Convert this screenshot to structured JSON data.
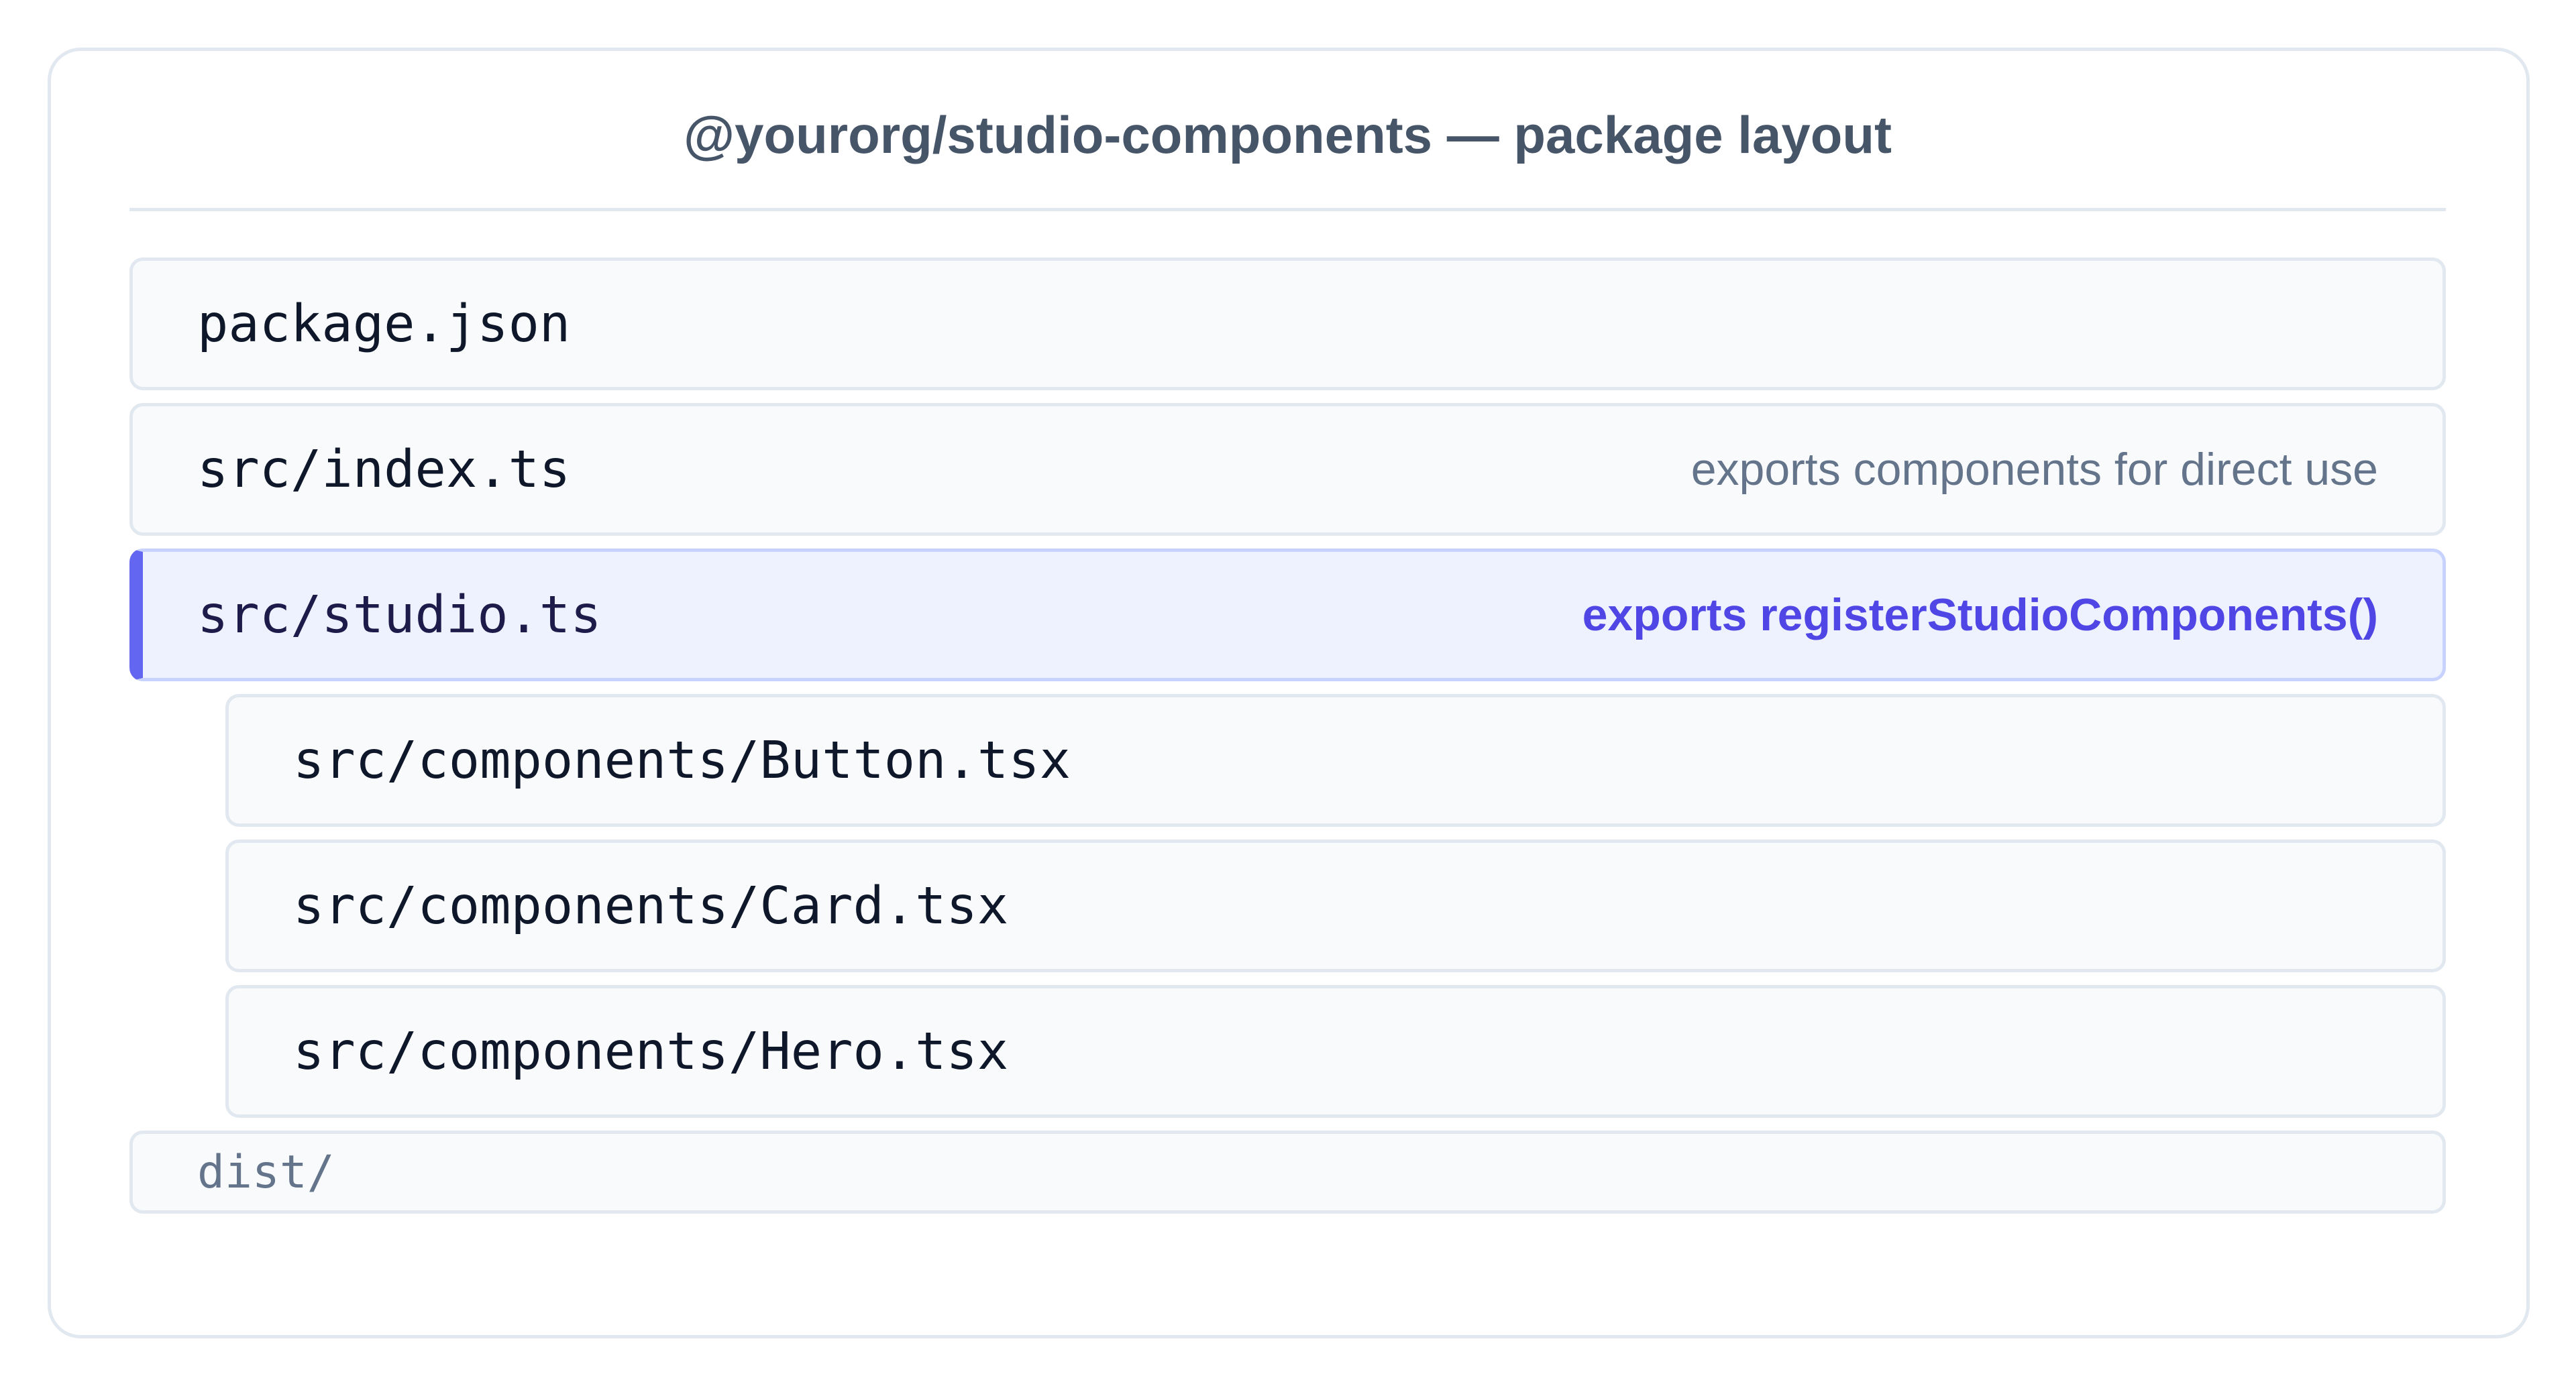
{
  "title": "@yourorg/studio-components — package layout",
  "rows": [
    {
      "path": "package.json",
      "note": ""
    },
    {
      "path": "src/index.ts",
      "note": "exports components for direct use"
    },
    {
      "path": "src/studio.ts",
      "note": "exports registerStudioComponents()"
    },
    {
      "path": "src/components/Button.tsx",
      "note": ""
    },
    {
      "path": "src/components/Card.tsx",
      "note": ""
    },
    {
      "path": "src/components/Hero.tsx",
      "note": ""
    },
    {
      "path": "dist/",
      "note": ""
    }
  ],
  "colors": {
    "accent": "#6366f1",
    "accent_text": "#4f46e5",
    "highlight_bg": "#eef2ff",
    "row_bg": "#f8fafc",
    "border": "#e2e8f0"
  }
}
